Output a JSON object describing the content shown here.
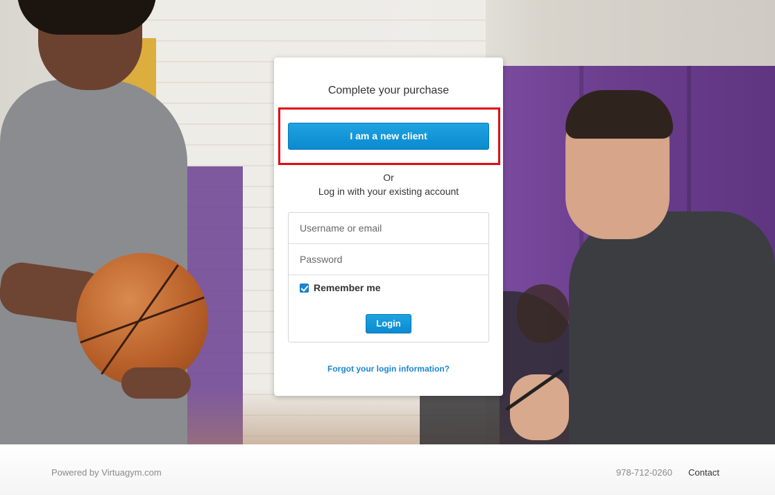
{
  "card": {
    "title": "Complete your purchase",
    "new_client_label": "I am a new client",
    "or_label": "Or",
    "login_subtitle": "Log in with your existing account",
    "username_placeholder": "Username or email",
    "password_placeholder": "Password",
    "remember_label": "Remember me",
    "remember_checked": true,
    "login_label": "Login",
    "forgot_label": "Forgot your login information?"
  },
  "footer": {
    "powered_by": "Powered by Virtuagym.com",
    "phone": "978-712-0260",
    "contact_label": "Contact"
  },
  "colors": {
    "accent": "#0b8ad0",
    "highlight": "#e30613",
    "link": "#1a86d6"
  }
}
